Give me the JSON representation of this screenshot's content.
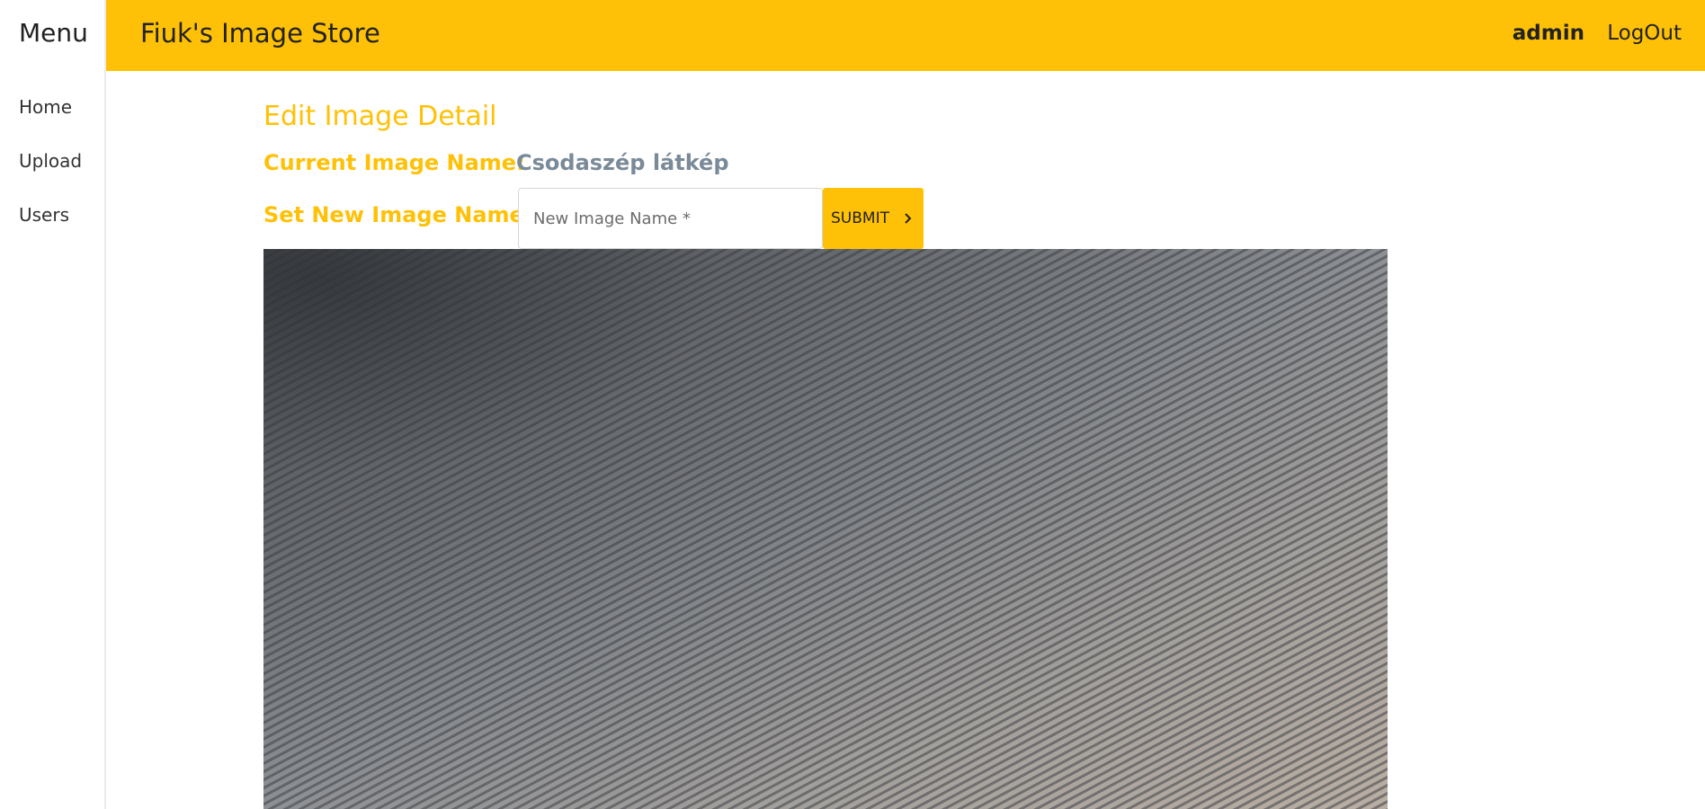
{
  "sidebar": {
    "title": "Menu",
    "items": [
      {
        "label": "Home"
      },
      {
        "label": "Upload"
      },
      {
        "label": "Users"
      }
    ]
  },
  "header": {
    "title": "Fiuk's Image Store",
    "user": "admin",
    "logout_label": "LogOut",
    "accent_color": "#ffc107"
  },
  "main": {
    "section_title": "Edit Image Detail",
    "current_label": "Current Image Name:",
    "current_value": "Csodaszép látkép",
    "new_label": "Set New Image Name:",
    "new_input": {
      "value": "",
      "placeholder": "New Image Name *"
    },
    "submit_label": "SUBMIT",
    "submit_icon": "chevron-right-icon"
  }
}
